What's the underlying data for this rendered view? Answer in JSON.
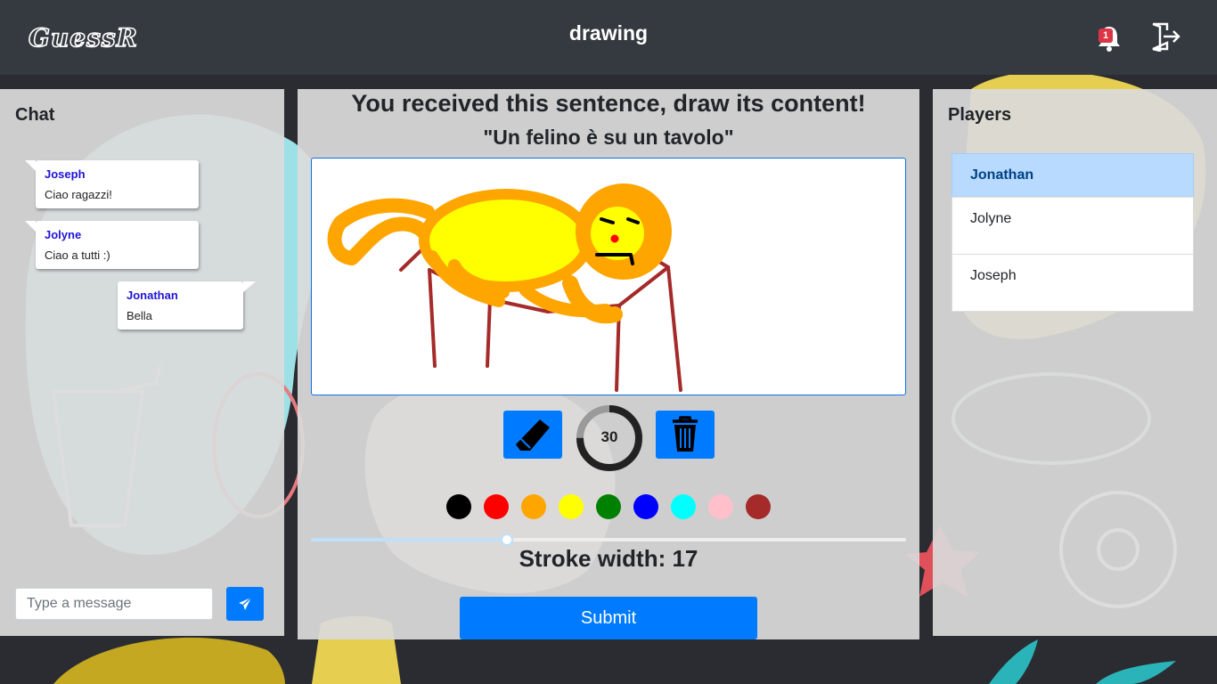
{
  "header": {
    "logo_text": "GuessR",
    "title": "drawing",
    "notification_count": "1",
    "bell_icon": "bell-icon",
    "logout_icon": "logout-icon"
  },
  "chat": {
    "title": "Chat",
    "messages": [
      {
        "author": "Joseph",
        "text": "Ciao ragazzi!",
        "side": "left"
      },
      {
        "author": "Jolyne",
        "text": "Ciao a tutti :)",
        "side": "left"
      },
      {
        "author": "Jonathan",
        "text": "Bella",
        "side": "right"
      }
    ],
    "input_placeholder": "Type a message",
    "send_icon": "paper-plane-icon"
  },
  "main": {
    "heading": "You received this sentence, draw its content!",
    "sentence": "\"Un felino è su un tavolo\"",
    "timer_value": "30",
    "timer_progress": 0.75,
    "eraser_icon": "eraser-icon",
    "trash_icon": "trash-icon",
    "colors": [
      {
        "name": "black",
        "hex": "#000000"
      },
      {
        "name": "red",
        "hex": "#ff0000"
      },
      {
        "name": "orange",
        "hex": "#ffa500"
      },
      {
        "name": "yellow",
        "hex": "#ffff00"
      },
      {
        "name": "green",
        "hex": "#008000"
      },
      {
        "name": "blue",
        "hex": "#0000ff"
      },
      {
        "name": "cyan",
        "hex": "#00ffff"
      },
      {
        "name": "pink",
        "hex": "#ffc0cb"
      },
      {
        "name": "brown",
        "hex": "#a52a2a"
      }
    ],
    "stroke_width_value": 17,
    "stroke_width_fraction": 0.33,
    "stroke_label": "Stroke width: 17",
    "submit_label": "Submit"
  },
  "players": {
    "title": "Players",
    "list": [
      {
        "name": "Jonathan",
        "active": true
      },
      {
        "name": "Jolyne",
        "active": false
      },
      {
        "name": "Joseph",
        "active": false
      }
    ]
  },
  "colors": {
    "header_bg": "#343a40",
    "primary": "#007bff",
    "active_player_bg": "#b8daff",
    "badge": "#dc3545"
  }
}
